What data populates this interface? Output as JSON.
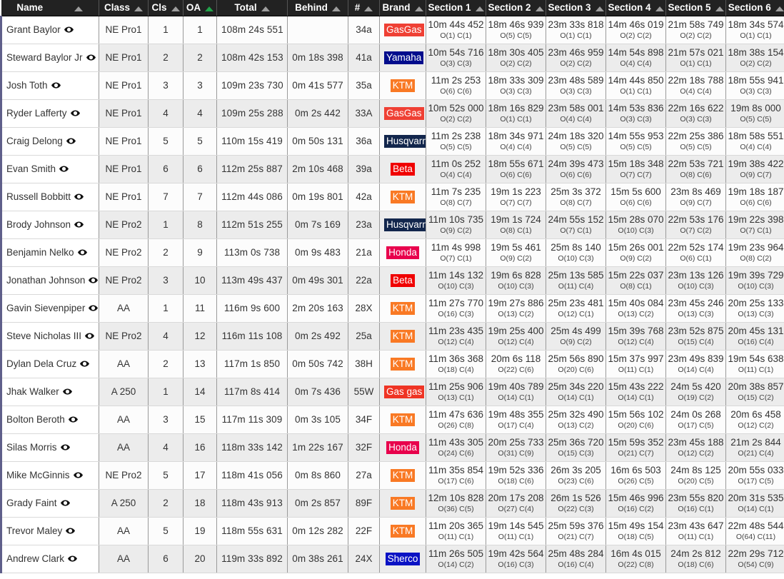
{
  "table": {
    "columns": [
      {
        "key": "name",
        "label": "Name",
        "sorted": false
      },
      {
        "key": "class",
        "label": "Class",
        "sorted": false
      },
      {
        "key": "cls",
        "label": "Cls",
        "sorted": false
      },
      {
        "key": "oa",
        "label": "OA",
        "sorted": true
      },
      {
        "key": "total",
        "label": "Total",
        "sorted": false
      },
      {
        "key": "behind",
        "label": "Behind",
        "sorted": false
      },
      {
        "key": "num",
        "label": "#",
        "sorted": false
      },
      {
        "key": "brand",
        "label": "Brand",
        "sorted": false
      },
      {
        "key": "sec1",
        "label": "Section 1",
        "sorted": false
      },
      {
        "key": "sec2",
        "label": "Section 2",
        "sorted": false
      },
      {
        "key": "sec3",
        "label": "Section 3",
        "sorted": false
      },
      {
        "key": "sec4",
        "label": "Section 4",
        "sorted": false
      },
      {
        "key": "sec5",
        "label": "Section 5",
        "sorted": false
      },
      {
        "key": "sec6",
        "label": "Section 6",
        "sorted": false
      }
    ],
    "brand_colors": {
      "GasGas": "#ef4034",
      "Yamaha": "#000c8c",
      "KTM": "#f97924",
      "Husqvarna": "#12264c",
      "Beta": "#f00000",
      "Honda": "#e8004c",
      "Gas gas": "#ef3424",
      "Sherco": "#0a12c4"
    },
    "rows": [
      {
        "name": "Grant Baylor",
        "class": "NE Pro1",
        "cls": "1",
        "oa": "1",
        "total": "108m 24s 551",
        "behind": "",
        "num": "34a",
        "brand": "GasGas",
        "sections": [
          {
            "time": "10m 44s 452",
            "oc": "O(1) C(1)"
          },
          {
            "time": "18m 46s 939",
            "oc": "O(5) C(5)"
          },
          {
            "time": "23m 33s 818",
            "oc": "O(1) C(1)"
          },
          {
            "time": "14m 46s 019",
            "oc": "O(2) C(2)"
          },
          {
            "time": "21m 58s 749",
            "oc": "O(2) C(2)"
          },
          {
            "time": "18m 34s 574",
            "oc": "O(1) C(1)"
          }
        ]
      },
      {
        "name": "Steward Baylor Jr",
        "class": "NE Pro1",
        "cls": "2",
        "oa": "2",
        "total": "108m 42s 153",
        "behind": "0m 18s 398",
        "num": "41a",
        "brand": "Yamaha",
        "sections": [
          {
            "time": "10m 54s 716",
            "oc": "O(3) C(3)"
          },
          {
            "time": "18m 30s 405",
            "oc": "O(2) C(2)"
          },
          {
            "time": "23m 46s 959",
            "oc": "O(2) C(2)"
          },
          {
            "time": "14m 54s 898",
            "oc": "O(4) C(4)"
          },
          {
            "time": "21m 57s 021",
            "oc": "O(1) C(1)"
          },
          {
            "time": "18m 38s 154",
            "oc": "O(2) C(2)"
          }
        ]
      },
      {
        "name": "Josh Toth",
        "class": "NE Pro1",
        "cls": "3",
        "oa": "3",
        "total": "109m 23s 730",
        "behind": "0m 41s 577",
        "num": "35a",
        "brand": "KTM",
        "sections": [
          {
            "time": "11m 2s 253",
            "oc": "O(6) C(6)"
          },
          {
            "time": "18m 33s 309",
            "oc": "O(3) C(3)"
          },
          {
            "time": "23m 48s 589",
            "oc": "O(3) C(3)"
          },
          {
            "time": "14m 44s 850",
            "oc": "O(1) C(1)"
          },
          {
            "time": "22m 18s 788",
            "oc": "O(4) C(4)"
          },
          {
            "time": "18m 55s 941",
            "oc": "O(3) C(3)"
          }
        ]
      },
      {
        "name": "Ryder Lafferty",
        "class": "NE Pro1",
        "cls": "4",
        "oa": "4",
        "total": "109m 25s 288",
        "behind": "0m 2s 442",
        "num": "33A",
        "brand": "GasGas",
        "sections": [
          {
            "time": "10m 52s 000",
            "oc": "O(2) C(2)"
          },
          {
            "time": "18m 16s 829",
            "oc": "O(1) C(1)"
          },
          {
            "time": "23m 58s 001",
            "oc": "O(4) C(4)"
          },
          {
            "time": "14m 53s 836",
            "oc": "O(3) C(3)"
          },
          {
            "time": "22m 16s 622",
            "oc": "O(3) C(3)"
          },
          {
            "time": "19m 8s 000",
            "oc": "O(5) C(5)"
          }
        ]
      },
      {
        "name": "Craig Delong",
        "class": "NE Pro1",
        "cls": "5",
        "oa": "5",
        "total": "110m 15s 419",
        "behind": "0m 50s 131",
        "num": "36a",
        "brand": "Husqvarna",
        "sections": [
          {
            "time": "11m 2s 238",
            "oc": "O(5) C(5)"
          },
          {
            "time": "18m 34s 971",
            "oc": "O(4) C(4)"
          },
          {
            "time": "24m 18s 320",
            "oc": "O(5) C(5)"
          },
          {
            "time": "14m 55s 953",
            "oc": "O(5) C(5)"
          },
          {
            "time": "22m 25s 386",
            "oc": "O(5) C(5)"
          },
          {
            "time": "18m 58s 551",
            "oc": "O(4) C(4)"
          }
        ]
      },
      {
        "name": "Evan Smith",
        "class": "NE Pro1",
        "cls": "6",
        "oa": "6",
        "total": "112m 25s 887",
        "behind": "2m 10s 468",
        "num": "39a",
        "brand": "Beta",
        "sections": [
          {
            "time": "11m 0s 252",
            "oc": "O(4) C(4)"
          },
          {
            "time": "18m 55s 671",
            "oc": "O(6) C(6)"
          },
          {
            "time": "24m 39s 473",
            "oc": "O(6) C(6)"
          },
          {
            "time": "15m 18s 348",
            "oc": "O(7) C(7)"
          },
          {
            "time": "22m 53s 721",
            "oc": "O(8) C(6)"
          },
          {
            "time": "19m 38s 422",
            "oc": "O(9) C(7)"
          }
        ]
      },
      {
        "name": "Russell Bobbitt",
        "class": "NE Pro1",
        "cls": "7",
        "oa": "7",
        "total": "112m 44s 086",
        "behind": "0m 19s 801",
        "num": "42a",
        "brand": "KTM",
        "sections": [
          {
            "time": "11m 7s 235",
            "oc": "O(8) C(7)"
          },
          {
            "time": "19m 1s 223",
            "oc": "O(7) C(7)"
          },
          {
            "time": "25m 3s 372",
            "oc": "O(8) C(7)"
          },
          {
            "time": "15m 5s 600",
            "oc": "O(6) C(6)"
          },
          {
            "time": "23m 8s 469",
            "oc": "O(9) C(7)"
          },
          {
            "time": "19m 18s 187",
            "oc": "O(6) C(6)"
          }
        ]
      },
      {
        "name": "Brody Johnson",
        "class": "NE Pro2",
        "cls": "1",
        "oa": "8",
        "total": "112m 51s 255",
        "behind": "0m 7s 169",
        "num": "23a",
        "brand": "Husqvarna",
        "sections": [
          {
            "time": "11m 10s 735",
            "oc": "O(9) C(2)"
          },
          {
            "time": "19m 1s 724",
            "oc": "O(8) C(1)"
          },
          {
            "time": "24m 55s 152",
            "oc": "O(7) C(1)"
          },
          {
            "time": "15m 28s 070",
            "oc": "O(10) C(3)"
          },
          {
            "time": "22m 53s 176",
            "oc": "O(7) C(2)"
          },
          {
            "time": "19m 22s 398",
            "oc": "O(7) C(1)"
          }
        ]
      },
      {
        "name": "Benjamin Nelko",
        "class": "NE Pro2",
        "cls": "2",
        "oa": "9",
        "total": "113m 0s 738",
        "behind": "0m 9s 483",
        "num": "21a",
        "brand": "Honda",
        "sections": [
          {
            "time": "11m 4s 998",
            "oc": "O(7) C(1)"
          },
          {
            "time": "19m 5s 461",
            "oc": "O(9) C(2)"
          },
          {
            "time": "25m 8s 140",
            "oc": "O(10) C(3)"
          },
          {
            "time": "15m 26s 001",
            "oc": "O(9) C(2)"
          },
          {
            "time": "22m 52s 174",
            "oc": "O(6) C(1)"
          },
          {
            "time": "19m 23s 964",
            "oc": "O(8) C(2)"
          }
        ]
      },
      {
        "name": "Jonathan Johnson",
        "class": "NE Pro2",
        "cls": "3",
        "oa": "10",
        "total": "113m 49s 437",
        "behind": "0m 49s 301",
        "num": "22a",
        "brand": "Beta",
        "sections": [
          {
            "time": "11m 14s 132",
            "oc": "O(10) C(3)"
          },
          {
            "time": "19m 6s 828",
            "oc": "O(10) C(3)"
          },
          {
            "time": "25m 13s 585",
            "oc": "O(11) C(4)"
          },
          {
            "time": "15m 22s 037",
            "oc": "O(8) C(1)"
          },
          {
            "time": "23m 13s 126",
            "oc": "O(10) C(3)"
          },
          {
            "time": "19m 39s 729",
            "oc": "O(10) C(3)"
          }
        ]
      },
      {
        "name": "Gavin Sievenpiper",
        "class": "AA",
        "cls": "1",
        "oa": "11",
        "total": "116m 9s 600",
        "behind": "2m 20s 163",
        "num": "28X",
        "brand": "KTM",
        "sections": [
          {
            "time": "11m 27s 770",
            "oc": "O(16) C(3)"
          },
          {
            "time": "19m 27s 886",
            "oc": "O(13) C(2)"
          },
          {
            "time": "25m 23s 481",
            "oc": "O(12) C(1)"
          },
          {
            "time": "15m 40s 084",
            "oc": "O(13) C(2)"
          },
          {
            "time": "23m 45s 246",
            "oc": "O(13) C(3)"
          },
          {
            "time": "20m 25s 133",
            "oc": "O(13) C(3)"
          }
        ]
      },
      {
        "name": "Steve Nicholas III",
        "class": "NE Pro2",
        "cls": "4",
        "oa": "12",
        "total": "116m 11s 108",
        "behind": "0m 2s 492",
        "num": "25a",
        "brand": "KTM",
        "sections": [
          {
            "time": "11m 23s 435",
            "oc": "O(12) C(4)"
          },
          {
            "time": "19m 25s 400",
            "oc": "O(12) C(4)"
          },
          {
            "time": "25m 4s 499",
            "oc": "O(9) C(2)"
          },
          {
            "time": "15m 39s 768",
            "oc": "O(12) C(4)"
          },
          {
            "time": "23m 52s 875",
            "oc": "O(15) C(4)"
          },
          {
            "time": "20m 45s 131",
            "oc": "O(16) C(4)"
          }
        ]
      },
      {
        "name": "Dylan Dela Cruz",
        "class": "AA",
        "cls": "2",
        "oa": "13",
        "total": "117m 1s 850",
        "behind": "0m 50s 742",
        "num": "38H",
        "brand": "KTM",
        "sections": [
          {
            "time": "11m 36s 368",
            "oc": "O(18) C(4)"
          },
          {
            "time": "20m 6s 118",
            "oc": "O(22) C(6)"
          },
          {
            "time": "25m 56s 890",
            "oc": "O(20) C(6)"
          },
          {
            "time": "15m 37s 997",
            "oc": "O(11) C(1)"
          },
          {
            "time": "23m 49s 839",
            "oc": "O(14) C(4)"
          },
          {
            "time": "19m 54s 638",
            "oc": "O(11) C(1)"
          }
        ]
      },
      {
        "name": "Jhak Walker",
        "class": "A 250",
        "cls": "1",
        "oa": "14",
        "total": "117m 8s 414",
        "behind": "0m 7s 436",
        "num": "55W",
        "brand": "Gas gas",
        "sections": [
          {
            "time": "11m 25s 906",
            "oc": "O(13) C(1)"
          },
          {
            "time": "19m 40s 789",
            "oc": "O(14) C(1)"
          },
          {
            "time": "25m 34s 220",
            "oc": "O(14) C(1)"
          },
          {
            "time": "15m 43s 222",
            "oc": "O(14) C(1)"
          },
          {
            "time": "24m 5s 420",
            "oc": "O(19) C(2)"
          },
          {
            "time": "20m 38s 857",
            "oc": "O(15) C(2)"
          }
        ]
      },
      {
        "name": "Bolton Beroth",
        "class": "AA",
        "cls": "3",
        "oa": "15",
        "total": "117m 11s 309",
        "behind": "0m 3s 105",
        "num": "34F",
        "brand": "KTM",
        "sections": [
          {
            "time": "11m 47s 636",
            "oc": "O(26) C(8)"
          },
          {
            "time": "19m 48s 355",
            "oc": "O(17) C(4)"
          },
          {
            "time": "25m 32s 490",
            "oc": "O(13) C(2)"
          },
          {
            "time": "15m 56s 102",
            "oc": "O(20) C(6)"
          },
          {
            "time": "24m 0s 268",
            "oc": "O(17) C(5)"
          },
          {
            "time": "20m 6s 458",
            "oc": "O(12) C(2)"
          }
        ]
      },
      {
        "name": "Silas Morris",
        "class": "AA",
        "cls": "4",
        "oa": "16",
        "total": "118m 33s 142",
        "behind": "1m 22s 167",
        "num": "32F",
        "brand": "Honda",
        "sections": [
          {
            "time": "11m 43s 305",
            "oc": "O(24) C(6)"
          },
          {
            "time": "20m 25s 733",
            "oc": "O(31) C(9)"
          },
          {
            "time": "25m 36s 720",
            "oc": "O(15) C(3)"
          },
          {
            "time": "15m 59s 352",
            "oc": "O(21) C(7)"
          },
          {
            "time": "23m 45s 188",
            "oc": "O(12) C(2)"
          },
          {
            "time": "21m 2s 844",
            "oc": "O(21) C(4)"
          }
        ]
      },
      {
        "name": "Mike McGinnis",
        "class": "NE Pro2",
        "cls": "5",
        "oa": "17",
        "total": "118m 41s 056",
        "behind": "0m 8s 860",
        "num": "27a",
        "brand": "KTM",
        "sections": [
          {
            "time": "11m 35s 854",
            "oc": "O(17) C(6)"
          },
          {
            "time": "19m 52s 336",
            "oc": "O(18) C(6)"
          },
          {
            "time": "26m 3s 205",
            "oc": "O(23) C(6)"
          },
          {
            "time": "16m 6s 503",
            "oc": "O(26) C(5)"
          },
          {
            "time": "24m 8s 125",
            "oc": "O(20) C(5)"
          },
          {
            "time": "20m 55s 033",
            "oc": "O(17) C(5)"
          }
        ]
      },
      {
        "name": "Grady Faint",
        "class": "A 250",
        "cls": "2",
        "oa": "18",
        "total": "118m 43s 913",
        "behind": "0m 2s 857",
        "num": "89F",
        "brand": "KTM",
        "sections": [
          {
            "time": "12m 10s 828",
            "oc": "O(36) C(5)"
          },
          {
            "time": "20m 17s 208",
            "oc": "O(27) C(4)"
          },
          {
            "time": "26m 1s 526",
            "oc": "O(22) C(3)"
          },
          {
            "time": "15m 46s 996",
            "oc": "O(16) C(2)"
          },
          {
            "time": "23m 55s 820",
            "oc": "O(16) C(1)"
          },
          {
            "time": "20m 31s 535",
            "oc": "O(14) C(1)"
          }
        ]
      },
      {
        "name": "Trevor Maley",
        "class": "AA",
        "cls": "5",
        "oa": "19",
        "total": "118m 55s 631",
        "behind": "0m 12s 282",
        "num": "22F",
        "brand": "KTM",
        "sections": [
          {
            "time": "11m 20s 365",
            "oc": "O(11) C(1)"
          },
          {
            "time": "19m 14s 545",
            "oc": "O(11) C(1)"
          },
          {
            "time": "25m 59s 376",
            "oc": "O(21) C(7)"
          },
          {
            "time": "15m 49s 154",
            "oc": "O(18) C(5)"
          },
          {
            "time": "23m 43s 647",
            "oc": "O(11) C(1)"
          },
          {
            "time": "22m 48s 544",
            "oc": "O(64) C(11)"
          }
        ]
      },
      {
        "name": "Andrew Clark",
        "class": "AA",
        "cls": "6",
        "oa": "20",
        "total": "119m 33s 892",
        "behind": "0m 38s 261",
        "num": "24X",
        "brand": "Sherco",
        "sections": [
          {
            "time": "11m 26s 505",
            "oc": "O(14) C(2)"
          },
          {
            "time": "19m 42s 564",
            "oc": "O(16) C(3)"
          },
          {
            "time": "25m 48s 284",
            "oc": "O(16) C(4)"
          },
          {
            "time": "16m 4s 015",
            "oc": "O(22) C(8)"
          },
          {
            "time": "24m 2s 812",
            "oc": "O(18) C(6)"
          },
          {
            "time": "22m 29s 712",
            "oc": "O(54) C(9)"
          }
        ]
      }
    ]
  }
}
